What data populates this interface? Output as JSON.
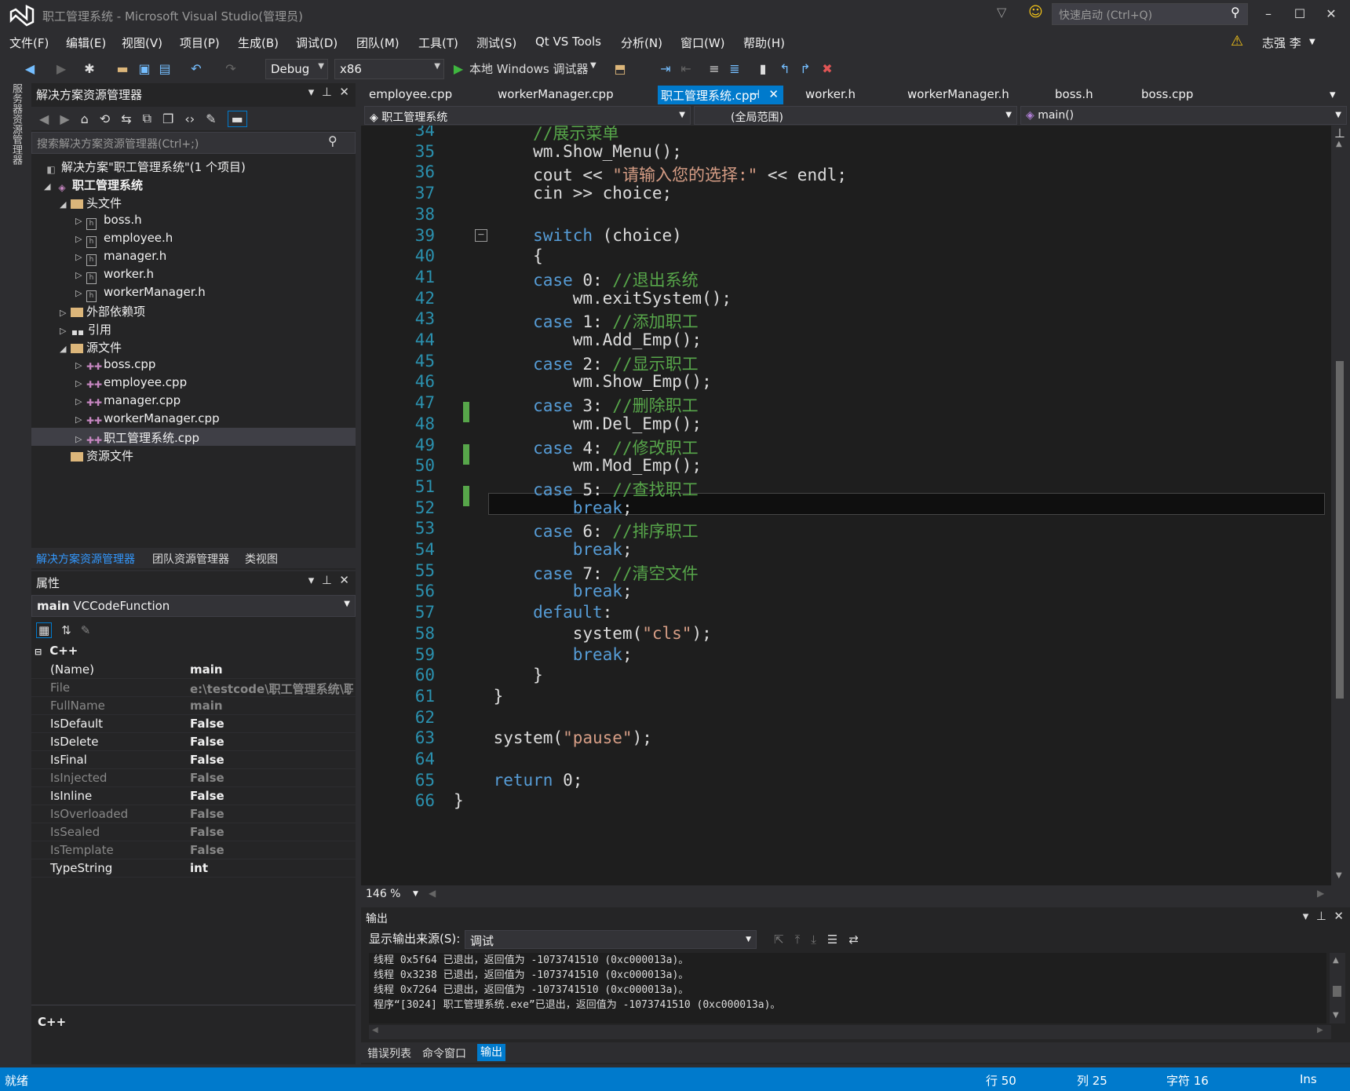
{
  "window": {
    "title": "职工管理系统 - Microsoft Visual Studio(管理员)",
    "quick_launch": "快速启动 (Ctrl+Q)",
    "user": "志强 李"
  },
  "menu": [
    "文件(F)",
    "编辑(E)",
    "视图(V)",
    "项目(P)",
    "生成(B)",
    "调试(D)",
    "团队(M)",
    "工具(T)",
    "测试(S)",
    "Qt VS Tools",
    "分析(N)",
    "窗口(W)",
    "帮助(H)"
  ],
  "toolbar": {
    "config": "Debug",
    "platform": "x86",
    "run_label": "本地 Windows 调试器"
  },
  "side_strip": "服务器资源管理器",
  "solution_explorer": {
    "title": "解决方案资源管理器",
    "search_placeholder": "搜索解决方案资源管理器(Ctrl+;)",
    "solution": "解决方案\"职工管理系统\"(1 个项目)",
    "project": "职工管理系统",
    "headers_folder": "头文件",
    "headers": [
      "boss.h",
      "employee.h",
      "manager.h",
      "worker.h",
      "workerManager.h"
    ],
    "external_deps": "外部依赖项",
    "references": "引用",
    "sources_folder": "源文件",
    "sources": [
      "boss.cpp",
      "employee.cpp",
      "manager.cpp",
      "workerManager.cpp",
      "职工管理系统.cpp"
    ],
    "resources_folder": "资源文件",
    "tabs": [
      "解决方案资源管理器",
      "团队资源管理器",
      "类视图"
    ]
  },
  "properties": {
    "title": "属性",
    "object": "main",
    "object_type": "VCCodeFunction",
    "category": "C++",
    "rows": [
      {
        "name": "(Name)",
        "value": "main"
      },
      {
        "name": "File",
        "value": "e:\\testcode\\职工管理系统\\职工"
      },
      {
        "name": "FullName",
        "value": "main"
      },
      {
        "name": "IsDefault",
        "value": "False"
      },
      {
        "name": "IsDelete",
        "value": "False"
      },
      {
        "name": "IsFinal",
        "value": "False"
      },
      {
        "name": "IsInjected",
        "value": "False"
      },
      {
        "name": "IsInline",
        "value": "False"
      },
      {
        "name": "IsOverloaded",
        "value": "False"
      },
      {
        "name": "IsSealed",
        "value": "False"
      },
      {
        "name": "IsTemplate",
        "value": "False"
      },
      {
        "name": "TypeString",
        "value": "int"
      }
    ],
    "description": "C++"
  },
  "editor": {
    "tabs": [
      "employee.cpp",
      "workerManager.cpp",
      "职工管理系统.cpp",
      "worker.h",
      "workerManager.h",
      "boss.h",
      "boss.cpp"
    ],
    "active_tab": "职工管理系统.cpp",
    "nav_project": "职工管理系统",
    "nav_scope": "(全局范围)",
    "nav_member": "main()",
    "zoom": "146 %",
    "lines": [
      {
        "n": "34",
        "t": [
          [
            "cm",
            "        //展示菜单"
          ]
        ]
      },
      {
        "n": "35",
        "t": [
          [
            "",
            "        wm.Show_Menu();"
          ]
        ]
      },
      {
        "n": "36",
        "t": [
          [
            "",
            "        cout << "
          ],
          [
            "st",
            "\"请输入您的选择:\""
          ],
          [
            "",
            " << endl;"
          ]
        ]
      },
      {
        "n": "37",
        "t": [
          [
            "",
            "        cin >> choice;"
          ]
        ]
      },
      {
        "n": "38",
        "t": [
          [
            "",
            ""
          ]
        ]
      },
      {
        "n": "39",
        "t": [
          [
            "kw",
            "        switch"
          ],
          [
            "",
            " (choice)"
          ]
        ]
      },
      {
        "n": "40",
        "t": [
          [
            "",
            "        {"
          ]
        ]
      },
      {
        "n": "41",
        "t": [
          [
            "kw",
            "        case"
          ],
          [
            "",
            " 0: "
          ],
          [
            "cm",
            "//退出系统"
          ]
        ]
      },
      {
        "n": "42",
        "t": [
          [
            "",
            "            wm.exitSystem();"
          ]
        ]
      },
      {
        "n": "43",
        "t": [
          [
            "kw",
            "        case"
          ],
          [
            "",
            " 1: "
          ],
          [
            "cm",
            "//添加职工"
          ]
        ]
      },
      {
        "n": "44",
        "t": [
          [
            "",
            "            wm.Add_Emp();"
          ]
        ]
      },
      {
        "n": "45",
        "t": [
          [
            "kw",
            "        case"
          ],
          [
            "",
            " 2: "
          ],
          [
            "cm",
            "//显示职工"
          ]
        ]
      },
      {
        "n": "46",
        "t": [
          [
            "",
            "            wm.Show_Emp();"
          ]
        ]
      },
      {
        "n": "47",
        "t": [
          [
            "kw",
            "        case"
          ],
          [
            "",
            " 3: "
          ],
          [
            "cm",
            "//删除职工"
          ]
        ]
      },
      {
        "n": "48",
        "t": [
          [
            "",
            "            wm.Del_Emp();"
          ]
        ]
      },
      {
        "n": "49",
        "t": [
          [
            "kw",
            "        case"
          ],
          [
            "",
            " 4: "
          ],
          [
            "cm",
            "//修改职工"
          ]
        ]
      },
      {
        "n": "50",
        "t": [
          [
            "",
            "            wm.Mod_Emp();"
          ]
        ]
      },
      {
        "n": "51",
        "t": [
          [
            "kw",
            "        case"
          ],
          [
            "",
            " 5: "
          ],
          [
            "cm",
            "//查找职工"
          ]
        ]
      },
      {
        "n": "52",
        "t": [
          [
            "kw",
            "            break"
          ],
          [
            "",
            ";"
          ]
        ]
      },
      {
        "n": "53",
        "t": [
          [
            "kw",
            "        case"
          ],
          [
            "",
            " 6: "
          ],
          [
            "cm",
            "//排序职工"
          ]
        ]
      },
      {
        "n": "54",
        "t": [
          [
            "kw",
            "            break"
          ],
          [
            "",
            ";"
          ]
        ]
      },
      {
        "n": "55",
        "t": [
          [
            "kw",
            "        case"
          ],
          [
            "",
            " 7: "
          ],
          [
            "cm",
            "//清空文件"
          ]
        ]
      },
      {
        "n": "56",
        "t": [
          [
            "kw",
            "            break"
          ],
          [
            "",
            ";"
          ]
        ]
      },
      {
        "n": "57",
        "t": [
          [
            "kw",
            "        default"
          ],
          [
            "",
            ":"
          ]
        ]
      },
      {
        "n": "58",
        "t": [
          [
            "",
            "            system("
          ],
          [
            "st",
            "\"cls\""
          ],
          [
            "",
            ");"
          ]
        ]
      },
      {
        "n": "59",
        "t": [
          [
            "kw",
            "            break"
          ],
          [
            "",
            ";"
          ]
        ]
      },
      {
        "n": "60",
        "t": [
          [
            "",
            "        }"
          ]
        ]
      },
      {
        "n": "61",
        "t": [
          [
            "",
            "    }"
          ]
        ]
      },
      {
        "n": "62",
        "t": [
          [
            "",
            ""
          ]
        ]
      },
      {
        "n": "63",
        "t": [
          [
            "",
            "    system("
          ],
          [
            "st",
            "\"pause\""
          ],
          [
            "",
            ");"
          ]
        ]
      },
      {
        "n": "64",
        "t": [
          [
            "",
            ""
          ]
        ]
      },
      {
        "n": "65",
        "t": [
          [
            "kw",
            "    return"
          ],
          [
            "",
            " 0;"
          ]
        ]
      },
      {
        "n": "66",
        "t": [
          [
            "",
            "}"
          ]
        ]
      }
    ]
  },
  "output": {
    "title": "输出",
    "source_label": "显示输出来源(S):",
    "source_value": "调试",
    "lines": [
      "线程 0x5f64 已退出，返回值为 -1073741510 (0xc000013a)。",
      "线程 0x3238 已退出，返回值为 -1073741510 (0xc000013a)。",
      "线程 0x7264 已退出，返回值为 -1073741510 (0xc000013a)。",
      "程序“[3024] 职工管理系统.exe”已退出，返回值为 -1073741510 (0xc000013a)。"
    ],
    "tabs": [
      "错误列表",
      "命令窗口",
      "输出"
    ]
  },
  "status": {
    "ready": "就绪",
    "line": "行 50",
    "col": "列 25",
    "ch": "字符 16",
    "mode": "Ins"
  }
}
